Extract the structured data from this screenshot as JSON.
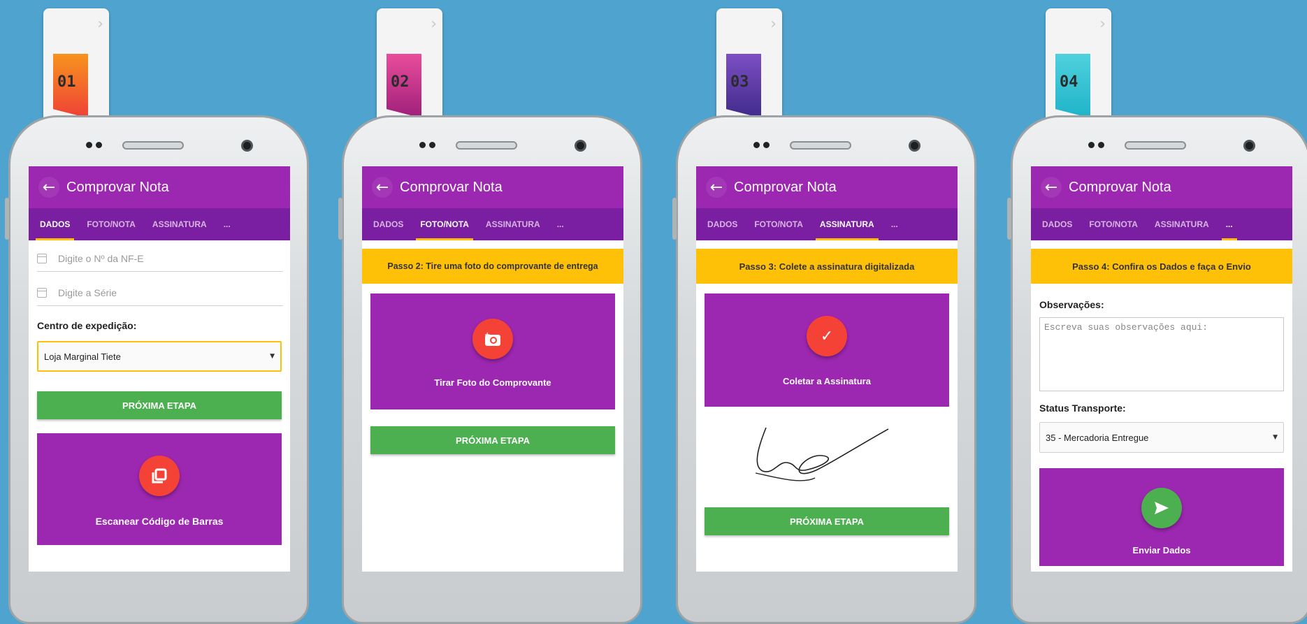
{
  "phones": [
    {
      "badge": "01",
      "badge_color": "#f15a24",
      "title": "Comprovar Nota",
      "tabs": [
        "DADOS",
        "FOTO/NOTA",
        "ASSINATURA",
        "..."
      ],
      "nf_placeholder": "Digite o Nº da NF-E",
      "serie_placeholder": "Digite a Série",
      "centro_label": "Centro de expedição:",
      "centro_value": "Loja Marginal Tiete",
      "next_button": "PRÓXIMA ETAPA",
      "scan_label": "Escanear Código de Barras"
    },
    {
      "badge": "02",
      "badge_color": "#c2228f",
      "title": "Comprovar Nota",
      "tabs": [
        "DADOS",
        "FOTO/NOTA",
        "ASSINATURA",
        "..."
      ],
      "step": "Passo 2: Tire uma foto do comprovante de entrega",
      "photo_label": "Tirar Foto do Comprovante",
      "next_button": "PRÓXIMA ETAPA"
    },
    {
      "badge": "03",
      "badge_color": "#5d2b9a",
      "title": "Comprovar Nota",
      "tabs": [
        "DADOS",
        "FOTO/NOTA",
        "ASSINATURA",
        "..."
      ],
      "step": "Passo 3: Colete a assinatura digitalizada",
      "sign_label": "Coletar a Assinatura",
      "next_button": "PRÓXIMA ETAPA"
    },
    {
      "badge": "04",
      "badge_color": "#1fb3c9",
      "title": "Comprovar Nota",
      "tabs": [
        "DADOS",
        "FOTO/NOTA",
        "ASSINATURA",
        "..."
      ],
      "step": "Passo 4: Confira os Dados e faça o Envio",
      "obs_label": "Observações:",
      "obs_placeholder": "Escreva suas observações aqui:",
      "status_label": "Status Transporte:",
      "status_value": "35 - Mercadoria Entregue",
      "send_label": "Enviar Dados"
    }
  ],
  "colors": {
    "background": "#4ea3cf",
    "appbar": "#9c27b0",
    "tabbar": "#7b1fa2",
    "step_banner": "#ffc107",
    "button_green": "#4caf50",
    "action_red": "#f44336"
  }
}
